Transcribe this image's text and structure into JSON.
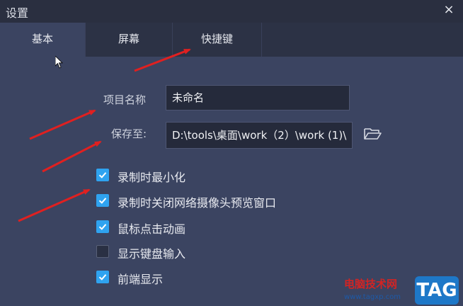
{
  "window": {
    "title": "设置",
    "close_glyph": "×"
  },
  "tabs": [
    {
      "label": "基本",
      "active": true
    },
    {
      "label": "屏幕",
      "active": false
    },
    {
      "label": "快捷键",
      "active": false
    }
  ],
  "form": {
    "project_name": {
      "label": "项目名称",
      "value": "未命名"
    },
    "save_to": {
      "label": "保存至:",
      "value": "D:\\tools\\桌面\\work（2）\\work (1)\\"
    }
  },
  "options": [
    {
      "label": "录制时最小化",
      "checked": true
    },
    {
      "label": "录制时关闭网络摄像头预览窗口",
      "checked": true
    },
    {
      "label": "鼠标点击动画",
      "checked": true
    },
    {
      "label": "显示键盘输入",
      "checked": false
    },
    {
      "label": "前端显示",
      "checked": true
    }
  ],
  "watermark": {
    "site_name": "电脑技术网",
    "url": "www.tagxp.com",
    "tag": "TAG"
  },
  "colors": {
    "accent": "#2fa3f0",
    "arrow": "#e02020",
    "background": "#3b4461"
  }
}
